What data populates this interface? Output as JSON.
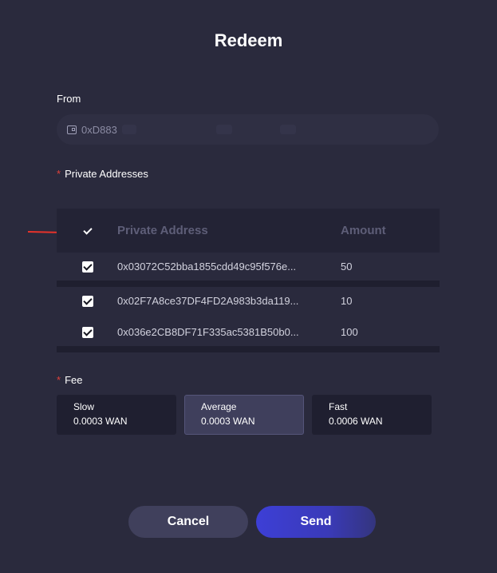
{
  "dialog": {
    "title": "Redeem"
  },
  "from": {
    "label": "From",
    "value": "0xD883",
    "icon": "wallet-icon"
  },
  "private_addresses": {
    "label": "Private Addresses",
    "required_mark": "*",
    "columns": [
      "Private Address",
      "Amount"
    ],
    "header_checked": true,
    "rows": [
      {
        "address": "0x03072C52bba1855cdd49c95f576e...",
        "amount": "50",
        "checked": true
      },
      {
        "address": "0x02F7A8ce37DF4FD2A983b3da119...",
        "amount": "10",
        "checked": true
      },
      {
        "address": "0x036e2CB8DF71F335ac5381B50b0...",
        "amount": "100",
        "checked": true
      }
    ]
  },
  "fee": {
    "label": "Fee",
    "required_mark": "*",
    "selected": "Average",
    "options": [
      {
        "name": "Slow",
        "value": "0.0003 WAN"
      },
      {
        "name": "Average",
        "value": "0.0003 WAN"
      },
      {
        "name": "Fast",
        "value": "0.0006 WAN"
      }
    ]
  },
  "buttons": {
    "cancel": "Cancel",
    "send": "Send"
  },
  "colors": {
    "background": "#2a2a3d",
    "required": "#e0413a",
    "send_button": "#3d3fd6",
    "annotation_arrow": "#e8322a"
  }
}
